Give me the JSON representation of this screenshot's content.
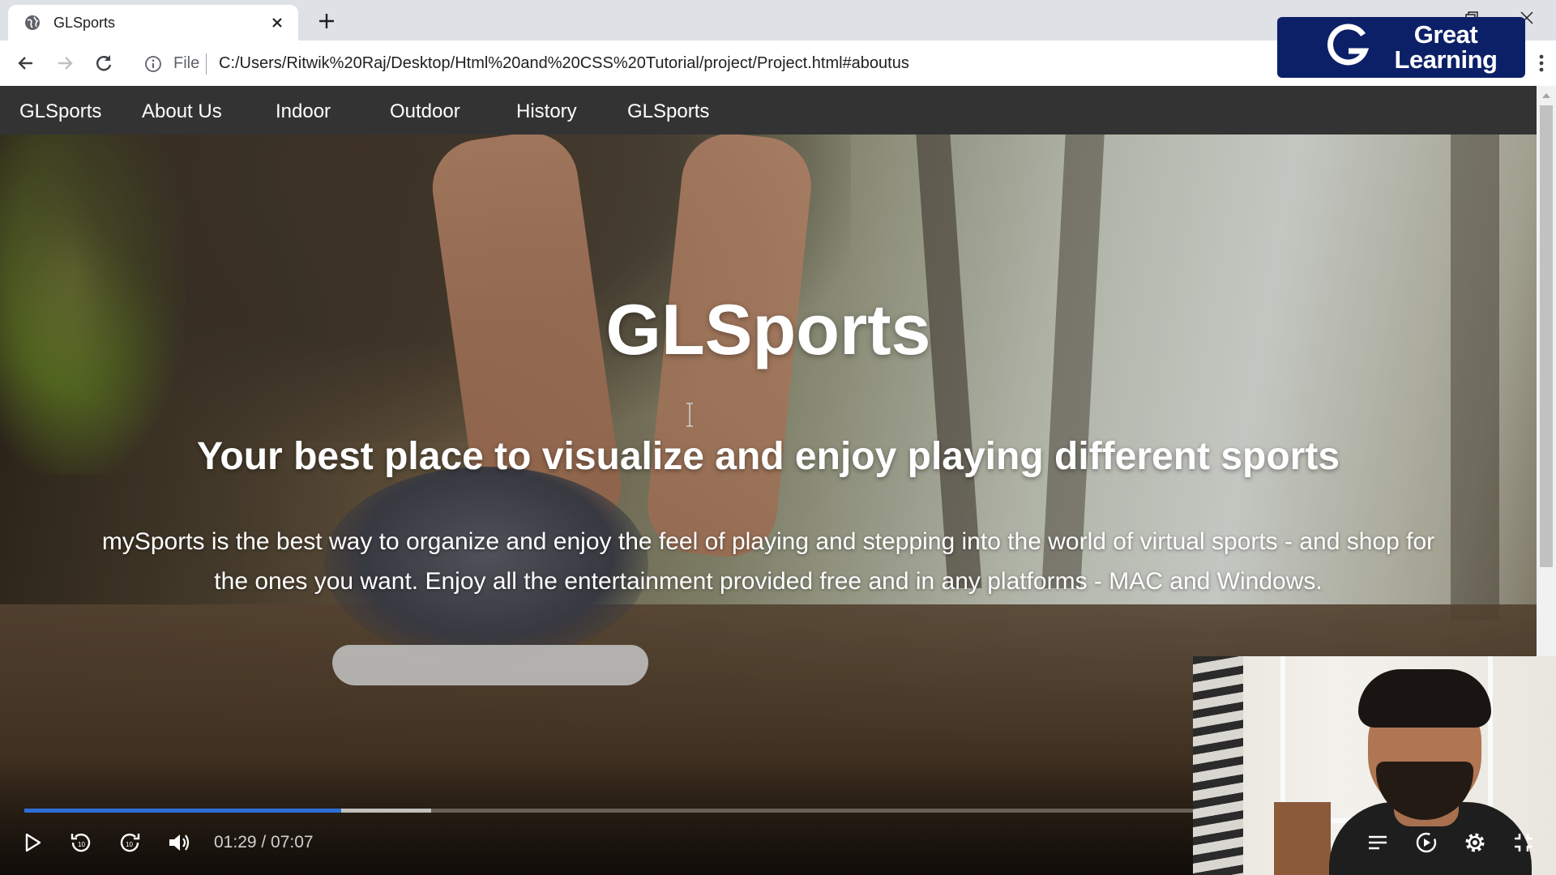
{
  "browser": {
    "tab_title": "GLSports",
    "file_label": "File",
    "url": "C:/Users/Ritwik%20Raj/Desktop/Html%20and%20CSS%20Tutorial/project/Project.html#aboutus"
  },
  "overlay_logo": {
    "line1": "Great",
    "line2": "Learning"
  },
  "site_nav": {
    "items": [
      {
        "label": "GLSports"
      },
      {
        "label": "About Us"
      },
      {
        "label": "Indoor"
      },
      {
        "label": "Outdoor"
      },
      {
        "label": "History"
      },
      {
        "label": "GLSports"
      }
    ]
  },
  "hero": {
    "title": "GLSports",
    "subtitle": "Your best place to visualize and enjoy playing different sports",
    "description_line1": "mySports is the best way to organize and enjoy the feel of playing and stepping into the world of virtual sports - and shop for",
    "description_line2": "the ones you want. Enjoy all the entertainment provided free and in any platforms - MAC and Windows."
  },
  "player": {
    "timecode": "01:29 / 07:07",
    "played_fraction": 0.21,
    "buffered_fraction": 0.27,
    "progress_color": "#2d6fd6",
    "icons": [
      "play-icon",
      "rewind-10-icon",
      "forward-10-icon",
      "volume-icon",
      "captions-icon",
      "speed-icon",
      "settings-gear-icon",
      "exit-fullscreen-icon"
    ]
  },
  "colors": {
    "site_nav_bg": "#333333",
    "brand_logo_bg": "#0c2068"
  }
}
